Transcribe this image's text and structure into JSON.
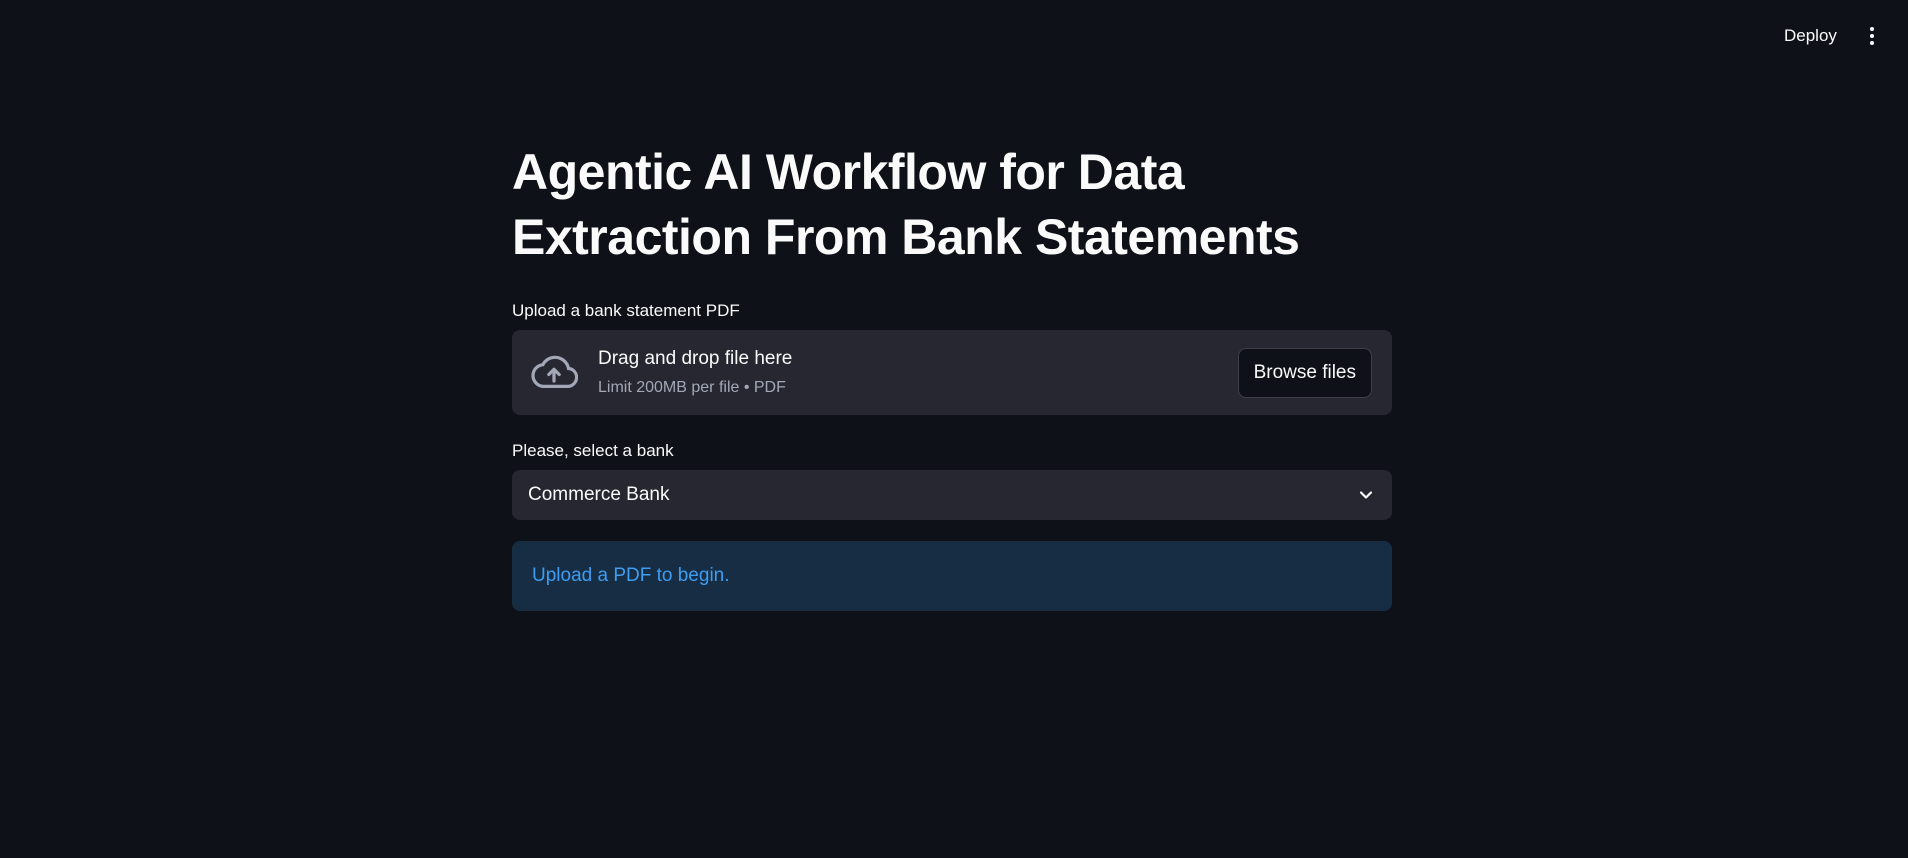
{
  "header": {
    "deploy_label": "Deploy",
    "menu_icon": "kebab-menu-icon"
  },
  "main": {
    "title": "Agentic AI Workflow for Data Extraction From Bank Statements",
    "uploader": {
      "label": "Upload a bank statement PDF",
      "drop_text": "Drag and drop file here",
      "limit_text": "Limit 200MB per file • PDF",
      "browse_label": "Browse files",
      "icon": "cloud-upload-icon"
    },
    "bank_select": {
      "label": "Please, select a bank",
      "value": "Commerce Bank",
      "icon": "chevron-down-icon"
    },
    "info": {
      "text": "Upload a PDF to begin."
    }
  },
  "colors": {
    "background": "#0e1117",
    "surface": "#262730",
    "text": "#fafafa",
    "muted": "#a3a8b8",
    "info_bg": "#172d43",
    "info_text": "#3d9df3"
  }
}
